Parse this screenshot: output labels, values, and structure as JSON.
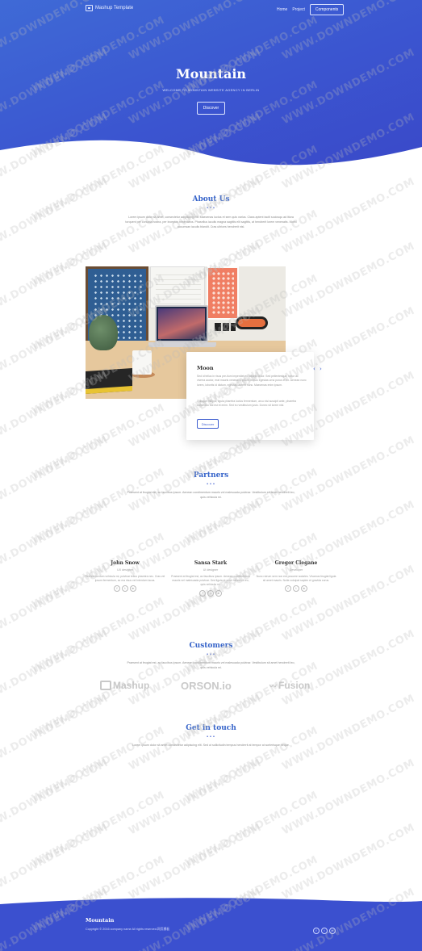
{
  "header": {
    "brand": "Mashup Template",
    "nav": [
      "Home",
      "Project"
    ],
    "nav_button": "Components"
  },
  "hero": {
    "title": "Mountain",
    "subtitle": "WELCOME TO MOUNTAIN WEBSITE AGENCY IN BERLIN",
    "button": "Discover"
  },
  "about": {
    "title": "About Us",
    "dots": "•••",
    "text": "Lorem ipsum dolor sit amet, consectetur adipiscing elit. Maecenas luctus et sem quis varius. Class aptent taciti sociosqu ad litora torquent per conubia nostra, per inceptos himenaeos. Phasellus iaculis magna sagittis elit sagittis, at hendrerit lorem venenatis. Morbi accumsan iaculis blandit. Cras ultrices hendrerit nisl."
  },
  "card": {
    "title": "Moon",
    "prev": "‹",
    "next": "›",
    "text1": "Sed id tellus in risus pre-tium imperdiet eu lobortis dolor. Sed pellentesque, tortor ac viverra auctor, erat mauris venenatis ipsum, metus egestas urna purus et ex. Aenean nunc lorem, lobortis id dictum, egestas laoreet nunc. Maecenas enim ipsum.",
    "text2": "Quisque magna, ligula pharetra luctus fermentum, arcu nisi suscipit ante, pharetra commodo dui est et enim. Sed eu vestibulum justo. Donec sit lorem nisl.",
    "button": "Discover"
  },
  "partners": {
    "title": "Partners",
    "dots": "•••",
    "text": "Praesent at feugiat est, ac faucibus ipsum. Aenean condimentum mauris vel malesuada pulvinar. Vestibulum sit amet hendrerit leo, quis vehicula mi.",
    "people": [
      {
        "name": "John Snow",
        "role": "UX designer",
        "text": "Sed elementum vehicula mi, pulvinar tellus pharetra nec. Cras vel ipsum fermentum, ac ma risus vel interdum lacus.",
        "socials": [
          "f",
          "t",
          "in"
        ]
      },
      {
        "name": "Sansa Stark",
        "role": "UI designer",
        "text": "Praesent at feugiat est, ac faucibus ipsum. Aenean condimentum mauris vel malesuada pulvinar. Sed ligula et amet hendrerit leo, quis vehicula mi.",
        "socials": [
          "f",
          "t",
          "in"
        ]
      },
      {
        "name": "Gregor Clegane",
        "role": "Developer",
        "text": "Nunc rutrum sem non est posuere sodales. Vivamus feugiat ligula sit amet mauris. Nulla volutpat sapien et gravida curus.",
        "socials": [
          "f",
          "t",
          "in"
        ]
      }
    ]
  },
  "customers": {
    "title": "Customers",
    "dots": "•••",
    "text": "Praesent at feugiat est, ac faucibus ipsum. Aenean condimentum mauris vel malesuada pulvinar. Vestibulum sit amet hendrerit leo, quis vehicula mi.",
    "logos": [
      "Mashup",
      "ORSON.io",
      "Fusion"
    ]
  },
  "contact": {
    "title": "Get in touch",
    "dots": "•••",
    "text": "Lorem ipsum dolor sit amet consectetur adipiscing elit. Sed ut sollicitudin tempus hendrerit at tempor at scelerisque neque."
  },
  "footer": {
    "title": "Mountain",
    "copyright": "Copyright © 2016 company name All rights reserved.网页模板",
    "socials": [
      "f",
      "t",
      "in"
    ]
  },
  "watermark": "WWW.DOWNDEMO.COM",
  "colors": {
    "primary": "#3b50cf",
    "accent": "#3563c9"
  }
}
